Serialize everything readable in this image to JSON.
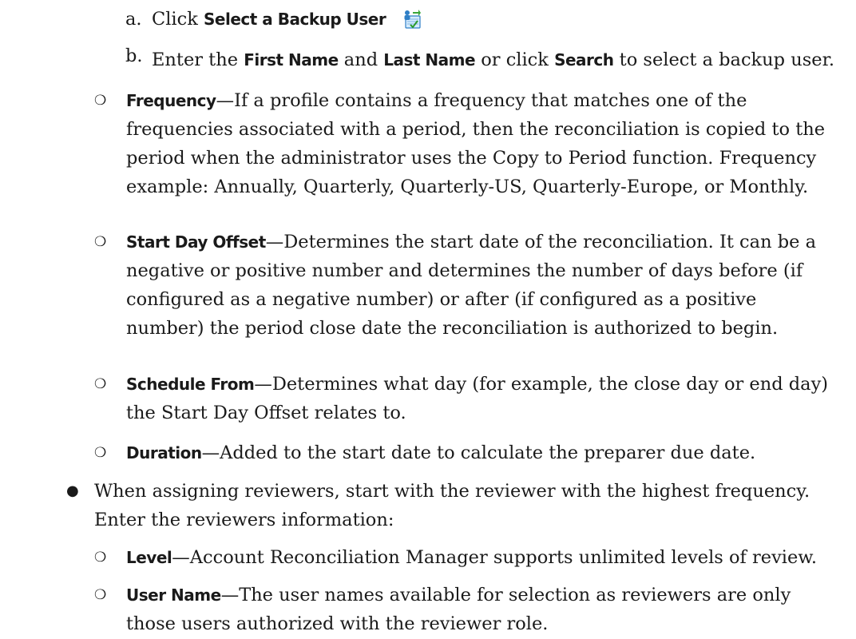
{
  "backup_steps": [
    {
      "marker": "a.",
      "click": "Click",
      "target": "Select a Backup User",
      "icon": "select-backup-user-icon"
    },
    {
      "marker": "b.",
      "t1": "Enter the",
      "b1": "First Name",
      "t2": "and",
      "b2": "Last Name",
      "t3": "or click",
      "b3": "Search",
      "t4": "to select a backup user."
    }
  ],
  "fields": [
    {
      "term": "Frequency",
      "desc": "—If a profile contains a frequency that matches one of the frequencies associated with a period, then the reconciliation is copied to the period when the administrator uses the Copy to Period function. Frequency example: Annually, Quarterly, Quarterly-US, Quarterly-Europe, or Monthly."
    },
    {
      "term": "Start Day Offset",
      "desc": "—Determines the start date of the reconciliation. It can be a negative or positive number and determines the number of days before (if configured as a negative number) or after (if configured as a positive number) the period close date the reconciliation is authorized to begin."
    },
    {
      "term": "Schedule From",
      "desc": "—Determines what day (for example, the close day or end day) the Start Day Offset relates to."
    },
    {
      "term": "Duration",
      "desc": "—Added to the start date to calculate the preparer due date."
    }
  ],
  "reviewers_intro": "When assigning reviewers, start with the reviewer with the highest frequency. Enter the reviewers information:",
  "reviewer_fields": [
    {
      "term": "Level",
      "desc": "—Account Reconciliation Manager supports unlimited levels of review."
    },
    {
      "term": "User Name",
      "desc": "—The user names available for selection as reviewers are only those users authorized with the reviewer role."
    }
  ],
  "bullets": {
    "open": "❍",
    "filled": "●"
  }
}
